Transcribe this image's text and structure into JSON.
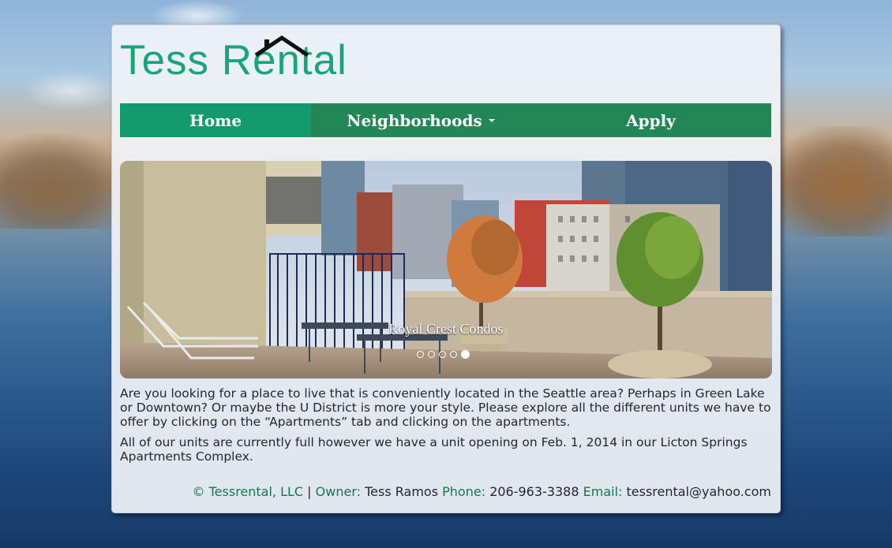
{
  "site": {
    "logo_text": "Tess Rental"
  },
  "nav": {
    "home": "Home",
    "neighborhoods": "Neighborhoods",
    "apply": "Apply"
  },
  "carousel": {
    "caption": "Royal Crest Condos",
    "slide_count": 5,
    "active_slide": 5
  },
  "content": {
    "paragraph1": "Are you looking for a place to live that is conveniently located in the Seattle area? Perhaps in Green Lake or Downtown? Or maybe the U District is more your style. Please explore all the different units we have to offer by clicking on the “Apartments” tab and clicking on the apartments.",
    "paragraph2": "All of our units are currently full however we have a unit opening on Feb. 1, 2014 in our Licton Springs Apartments Complex."
  },
  "footer": {
    "copyright": "© Tessrental, LLC",
    "separator": " | ",
    "owner_label": "Owner:",
    "owner_name": "Tess Ramos",
    "phone_label": "Phone:",
    "phone": "206-963-3388",
    "email_label": "Email:",
    "email": "tessrental@yahoo.com"
  },
  "colors": {
    "brand_green": "#18a57a",
    "nav_green": "#238657",
    "nav_active": "#149b6d",
    "footer_label": "#12774e"
  }
}
